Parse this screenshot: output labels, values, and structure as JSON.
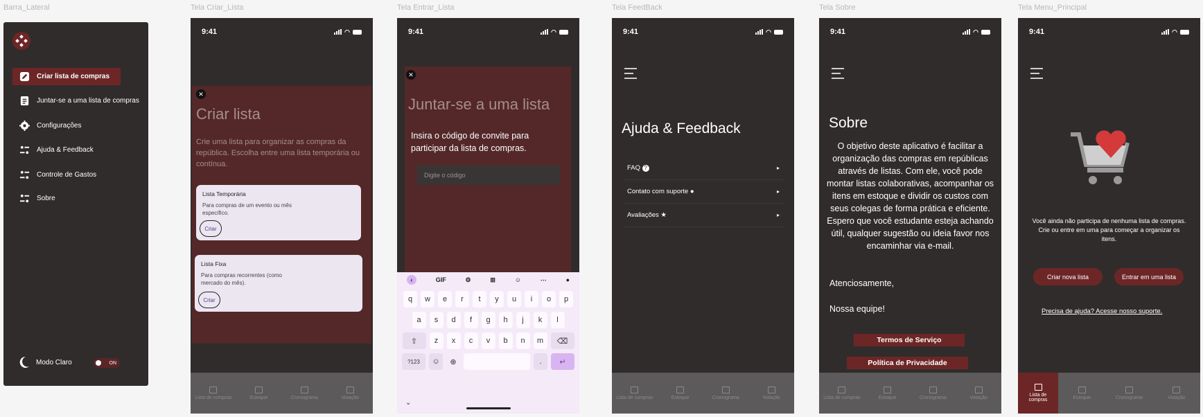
{
  "frames": {
    "sidebar": "Barra_Lateral",
    "criar": "Tela Criar_Lista",
    "entrar": "Tela Entrar_Lista",
    "feedback": "Tela FeedBack",
    "sobre": "Tela Sobre",
    "menu": "Tela Menu_Principal"
  },
  "status_time": "9:41",
  "colors": {
    "accent": "#6d2626",
    "panel": "#312c2c",
    "modal": "#542828",
    "nav": "#5c5a5a"
  },
  "sidebar": {
    "items": [
      {
        "label": "Criar lista de compras",
        "icon": "pencil-icon"
      },
      {
        "label": "Juntar-se a uma lista de compras",
        "icon": "document-icon"
      },
      {
        "label": "Configurações",
        "icon": "gear-icon"
      },
      {
        "label": "Ajuda & Feedback",
        "icon": "sliders-icon"
      },
      {
        "label": "Controle de Gastos",
        "icon": "sliders-icon"
      },
      {
        "label": "Sobre",
        "icon": "sliders-icon"
      }
    ],
    "mode_label": "Modo Claro",
    "toggle_label": "ON"
  },
  "bottom_nav": [
    "Lista de compras",
    "Estoque",
    "Cronograma",
    "Votação"
  ],
  "bottom_nav_active": "Lista de\ncompras",
  "criar": {
    "title": "Criar lista",
    "desc": "Crie uma lista para organizar as compras da república. Escolha entre uma lista temporária ou contínua.",
    "cards": [
      {
        "title": "Lista Temporária",
        "desc": "Para compras de um evento ou mês específico.",
        "button": "Criar"
      },
      {
        "title": "Lista Fixa",
        "desc": "Para compras recorrentes (como mercado do mês).",
        "button": "Criar"
      }
    ]
  },
  "entrar": {
    "title": "Juntar-se a uma lista",
    "desc": "Insira o código de convite para participar da lista de compras.",
    "placeholder": "Digite o código",
    "kb_gif": "GIF",
    "kb_rows": [
      [
        "q",
        "w",
        "e",
        "r",
        "t",
        "y",
        "u",
        "i",
        "o",
        "p"
      ],
      [
        "a",
        "s",
        "d",
        "f",
        "g",
        "h",
        "j",
        "k",
        "l"
      ],
      [
        "z",
        "x",
        "c",
        "v",
        "b",
        "n",
        "m"
      ]
    ],
    "kb_numbers": "?123",
    "kb_dot": "."
  },
  "feedback": {
    "title": "Ajuda & Feedback",
    "rows": [
      "FAQ",
      "Contato com suporte",
      "Avaliações"
    ]
  },
  "sobre": {
    "title": "Sobre",
    "body": "O objetivo deste aplicativo é facilitar a organização das compras em repúblicas através de listas. Com ele, você pode montar listas colaborativas, acompanhar os itens em estoque e dividir os custos com seus colegas de forma prática e eficiente. Espero que você estudante esteja achando útil, qualquer sugestão ou ideia favor nos encaminhar via e-mail.",
    "regards": "Atenciosamente,",
    "signature": "Nossa equipe!",
    "terms": "Termos de Serviço",
    "privacy": "Política de Privacidade"
  },
  "menu": {
    "message": "Você ainda não participa de nenhuma lista de compras. Crie ou entre em uma para começar a organizar os itens.",
    "create": "Criar nova lista",
    "join": "Entrar em uma lista",
    "help": "Precisa de ajuda? Acesse nosso suporte."
  }
}
